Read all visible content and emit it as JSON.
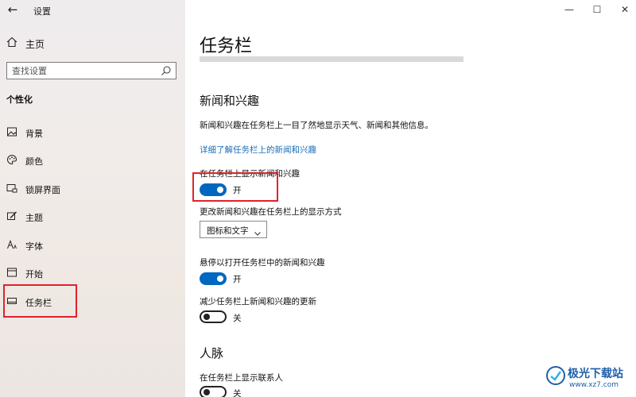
{
  "app": {
    "title": "设置",
    "back_icon": "back-arrow-icon"
  },
  "sidebar": {
    "home_label": "主页",
    "search_placeholder": "查找设置",
    "section_label": "个性化",
    "items": [
      {
        "label": "背景",
        "icon": "picture-icon"
      },
      {
        "label": "颜色",
        "icon": "palette-icon"
      },
      {
        "label": "锁屏界面",
        "icon": "lock-screen-icon"
      },
      {
        "label": "主题",
        "icon": "theme-brush-icon"
      },
      {
        "label": "字体",
        "icon": "font-icon"
      },
      {
        "label": "开始",
        "icon": "start-icon"
      },
      {
        "label": "任务栏",
        "icon": "taskbar-icon",
        "selected": true
      }
    ]
  },
  "window_controls": {
    "minimize": "—",
    "maximize": "☐",
    "close": "✕"
  },
  "main": {
    "title": "任务栏",
    "news_section": {
      "heading": "新闻和兴趣",
      "description": "新闻和兴趣在任务栏上一目了然地显示天气、新闻和其他信息。",
      "learn_more_link": "详细了解任务栏上的新闻和兴趣",
      "show_setting": {
        "label": "在任务栏上显示新闻和兴趣",
        "state": "开",
        "on": true
      },
      "display_mode": {
        "label": "更改新闻和兴趣在任务栏上的显示方式",
        "selected": "图标和文字"
      },
      "hover_setting": {
        "label": "悬停以打开任务栏中的新闻和兴趣",
        "state": "开",
        "on": true
      },
      "reduce_updates": {
        "label": "减少任务栏上新闻和兴趣的更新",
        "state": "关",
        "on": false
      }
    },
    "people_section": {
      "heading": "人脉",
      "show_contacts": {
        "label": "在任务栏上显示联系人",
        "state": "关",
        "on": false
      }
    }
  },
  "watermark": {
    "name": "极光下载站",
    "url": "www.xz7.com"
  },
  "colors": {
    "accent": "#0067c0",
    "highlight_box": "#e0232b",
    "link": "#1a6fb6"
  }
}
